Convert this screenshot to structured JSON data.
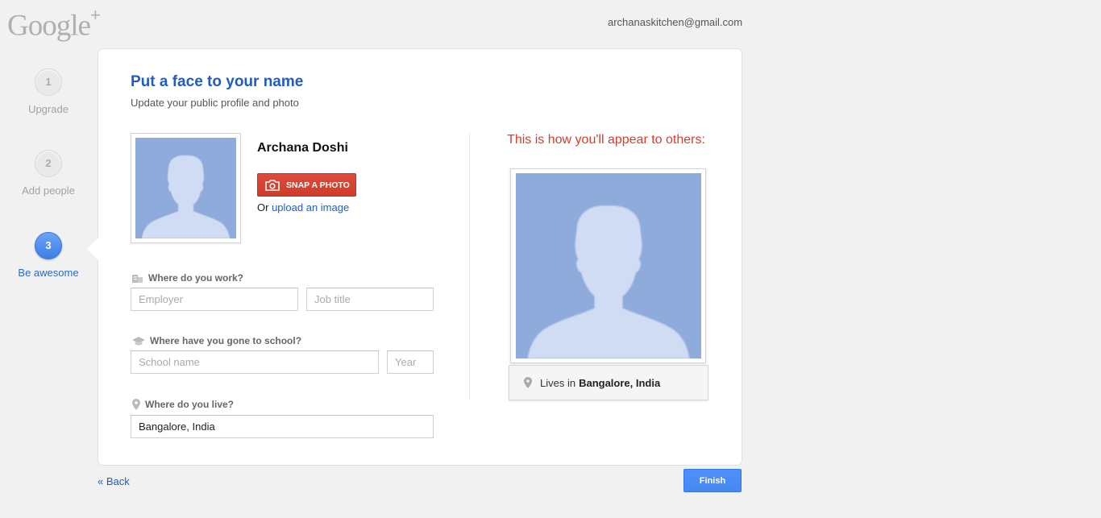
{
  "brand": {
    "logo_text": "Google",
    "logo_plus": "+"
  },
  "account": {
    "email": "archanaskitchen@gmail.com"
  },
  "steps": [
    {
      "number": "1",
      "label": "Upgrade",
      "active": false
    },
    {
      "number": "2",
      "label": "Add people",
      "active": false
    },
    {
      "number": "3",
      "label": "Be awesome",
      "active": true
    }
  ],
  "card": {
    "title": "Put a face to your name",
    "subtitle": "Update your public profile and photo",
    "profile_name": "Archana Doshi",
    "snap_button": "SNAP A PHOTO",
    "or_text": "Or ",
    "upload_link": "upload an image"
  },
  "form": {
    "work_label": "Where do you work?",
    "employer_placeholder": "Employer",
    "jobtitle_placeholder": "Job title",
    "school_label": "Where have you gone to school?",
    "school_placeholder": "School name",
    "year_placeholder": "Year",
    "live_label": "Where do you live?",
    "live_value": "Bangalore, India"
  },
  "preview": {
    "heading": "This is how you'll appear to others:",
    "lives_prefix": "Lives in",
    "lives_value": "Bangalore, India"
  },
  "footer": {
    "back_label": "« Back",
    "finish_label": "Finish"
  },
  "colors": {
    "accent_blue": "#1f5cc4",
    "snap_red": "#dd4b39",
    "finish_blue": "#4d90fe",
    "avatar_bg": "#8eabdc",
    "avatar_fg": "#cfdcf3"
  }
}
